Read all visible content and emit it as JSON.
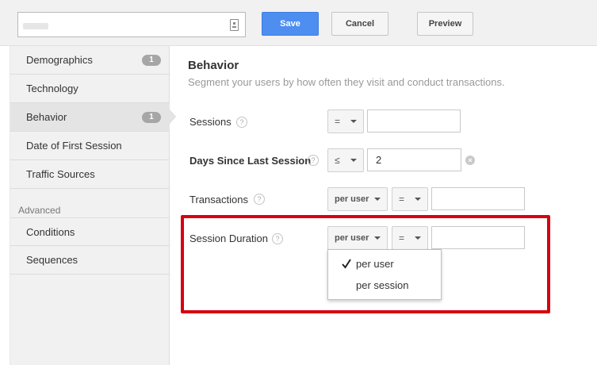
{
  "toolbar": {
    "save_label": "Save",
    "cancel_label": "Cancel",
    "preview_label": "Preview"
  },
  "sidebar": {
    "items": [
      {
        "label": "Demographics",
        "badge": "1"
      },
      {
        "label": "Technology"
      },
      {
        "label": "Behavior",
        "badge": "1",
        "active": true
      },
      {
        "label": "Date of First Session"
      },
      {
        "label": "Traffic Sources"
      }
    ],
    "advanced_heading": "Advanced",
    "advanced_items": [
      {
        "label": "Conditions"
      },
      {
        "label": "Sequences"
      }
    ]
  },
  "main": {
    "title": "Behavior",
    "subtitle": "Segment your users by how often they visit and conduct transactions.",
    "rows": [
      {
        "label": "Sessions",
        "operator": "=",
        "value": ""
      },
      {
        "label": "Days Since Last Session",
        "operator": "≤",
        "value": "2"
      },
      {
        "label": "Transactions",
        "scope": "per user",
        "operator": "=",
        "value": ""
      },
      {
        "label": "Session Duration",
        "scope": "per user",
        "operator": "=",
        "value": ""
      }
    ],
    "help_glyph": "?",
    "clear_glyph": "×"
  },
  "scope_dropdown": {
    "options": [
      "per user",
      "per session"
    ],
    "selected": "per user"
  },
  "colors": {
    "save_button": "#4d8ef0",
    "highlight": "#d7000f",
    "sidebar_bg": "#f1f1f1"
  }
}
